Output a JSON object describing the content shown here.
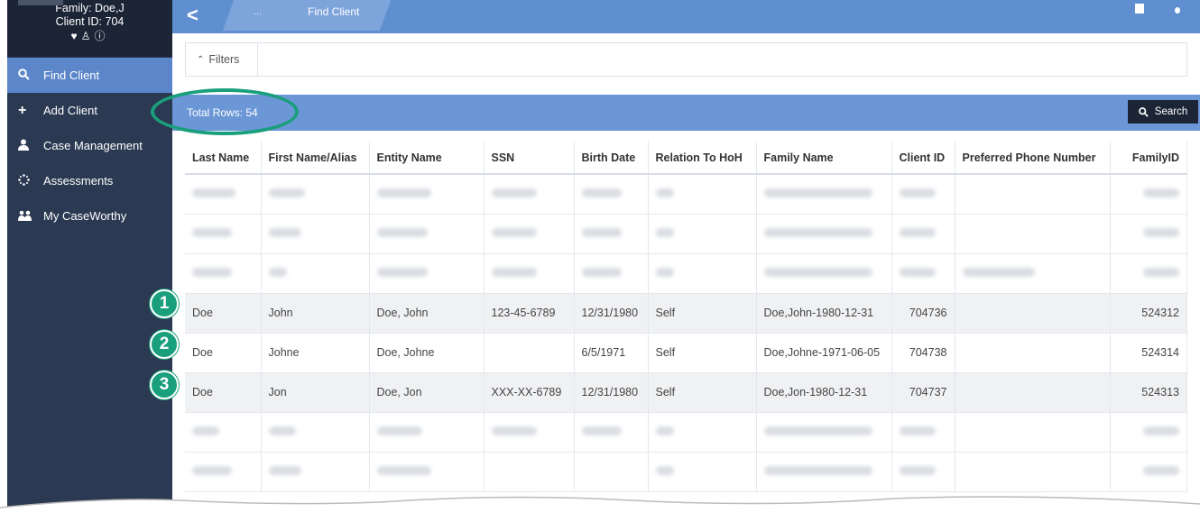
{
  "sidebar": {
    "client": {
      "family": "Family: Doe,J",
      "client_id": "Client ID: 704"
    },
    "items": [
      {
        "label": "Find Client",
        "icon": "search-icon",
        "active": true
      },
      {
        "label": "Add Client",
        "icon": "plus-icon",
        "active": false
      },
      {
        "label": "Case Management",
        "icon": "user-icon",
        "active": false
      },
      {
        "label": "Assessments",
        "icon": "spinner-icon",
        "active": false
      },
      {
        "label": "My CaseWorthy",
        "icon": "users-icon",
        "active": false
      }
    ]
  },
  "topbar": {
    "crumb_prev": "...",
    "crumb_current": "Find Client"
  },
  "filters": {
    "label": "Filters"
  },
  "results": {
    "total_rows": "Total Rows: 54",
    "search_label": "Search"
  },
  "table": {
    "columns": [
      "Last Name",
      "First Name/Alias",
      "Entity Name",
      "SSN",
      "Birth Date",
      "Relation To HoH",
      "Family Name",
      "Client ID",
      "Preferred Phone Number",
      "FamilyID"
    ],
    "rows": [
      {
        "last": "Doe",
        "first": "John",
        "entity": "Doe, John",
        "ssn": "123-45-6789",
        "birth": "12/31/1980",
        "relation": "Self",
        "family": "Doe,John-1980-12-31",
        "client_id": "704736",
        "phone": "",
        "family_id": "524312"
      },
      {
        "last": "Doe",
        "first": "Johne",
        "entity": "Doe, Johne",
        "ssn": "",
        "birth": "6/5/1971",
        "relation": "Self",
        "family": "Doe,Johne-1971-06-05",
        "client_id": "704738",
        "phone": "",
        "family_id": "524314"
      },
      {
        "last": "Doe",
        "first": "Jon",
        "entity": "Doe, Jon",
        "ssn": "XXX-XX-6789",
        "birth": "12/31/1980",
        "relation": "Self",
        "family": "Doe,Jon-1980-12-31",
        "client_id": "704737",
        "phone": "",
        "family_id": "524313"
      }
    ]
  },
  "badges": [
    "1",
    "2",
    "3"
  ],
  "colors": {
    "accent": "#1a9f7c",
    "sidebar": "#2b3a52",
    "topbar": "#5f8fd0"
  }
}
